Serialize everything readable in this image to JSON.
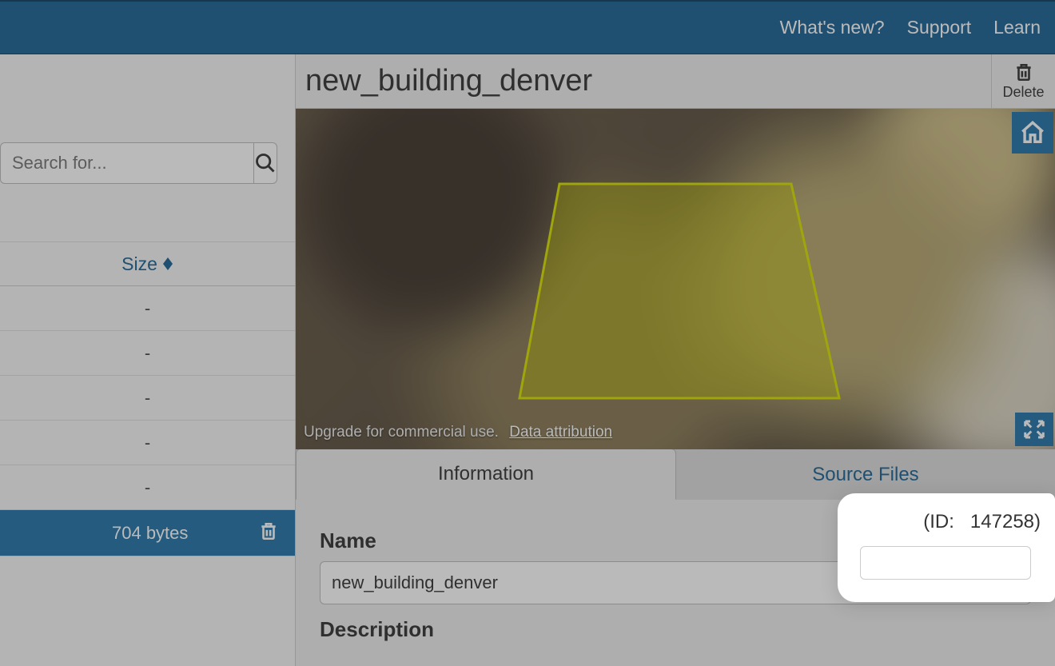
{
  "topnav": {
    "whats_new": "What's new?",
    "support": "Support",
    "learn": "Learn"
  },
  "search": {
    "placeholder": "Search for..."
  },
  "table": {
    "size_header": "Size",
    "rows": [
      {
        "size": "-"
      },
      {
        "size": "-"
      },
      {
        "size": "-"
      },
      {
        "size": "-"
      },
      {
        "size": "-"
      },
      {
        "size": "704 bytes",
        "selected": true
      }
    ]
  },
  "detail": {
    "title": "new_building_denver",
    "delete_label": "Delete",
    "map": {
      "upgrade_text": "Upgrade for commercial use.",
      "attribution_text": "Data attribution"
    },
    "tabs": {
      "information": "Information",
      "source_files": "Source Files"
    },
    "form": {
      "name_label": "Name",
      "name_value": "new_building_denver",
      "description_label": "Description"
    },
    "id_label": "(ID:",
    "id_value": "147258)",
    "id_full": "(ID:   147258)"
  }
}
